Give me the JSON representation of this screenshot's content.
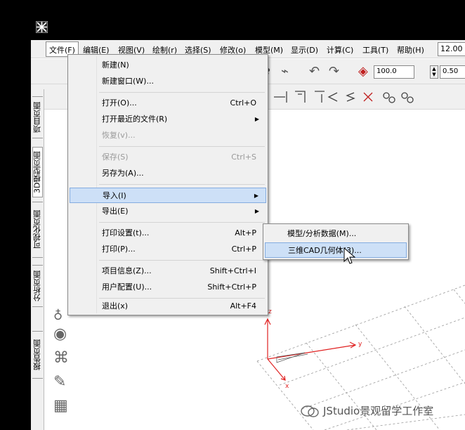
{
  "menubar": {
    "items": [
      "文件(F)",
      "编辑(E)",
      "视图(V)",
      "绘制(r)",
      "选择(S)",
      "修改(o)",
      "模型(M)",
      "显示(D)",
      "计算(C)",
      "工具(T)",
      "帮助(H)"
    ],
    "zoom_value": "12.00"
  },
  "toolbar": {
    "spin1_value": "100.0",
    "spin2_value": "0.50"
  },
  "file_menu": {
    "items": [
      {
        "label": "新建(N)",
        "shortcut": "",
        "disabled": false,
        "submenu": false
      },
      {
        "label": "新建窗口(W)...",
        "shortcut": "",
        "disabled": false,
        "submenu": false
      },
      {
        "label": "打开(O)...",
        "shortcut": "Ctrl+O",
        "disabled": false,
        "submenu": false
      },
      {
        "label": "打开最近的文件(R)",
        "shortcut": "",
        "disabled": false,
        "submenu": true
      },
      {
        "label": "恢复(v)...",
        "shortcut": "",
        "disabled": true,
        "submenu": false
      },
      {
        "label": "保存(S)",
        "shortcut": "Ctrl+S",
        "disabled": true,
        "submenu": false
      },
      {
        "label": "另存为(A)...",
        "shortcut": "",
        "disabled": false,
        "submenu": false
      },
      {
        "label": "导入(I)",
        "shortcut": "",
        "disabled": false,
        "submenu": true,
        "highlighted": true
      },
      {
        "label": "导出(E)",
        "shortcut": "",
        "disabled": false,
        "submenu": true
      },
      {
        "label": "打印设置(t)...",
        "shortcut": "Alt+P",
        "disabled": false,
        "submenu": false
      },
      {
        "label": "打印(P)...",
        "shortcut": "Ctrl+P",
        "disabled": false,
        "submenu": false
      },
      {
        "label": "项目信息(Z)...",
        "shortcut": "Shift+Ctrl+I",
        "disabled": false,
        "submenu": false
      },
      {
        "label": "用户配置(U)...",
        "shortcut": "Shift+Ctrl+P",
        "disabled": false,
        "submenu": false
      },
      {
        "label": "退出(x)",
        "shortcut": "Alt+F4",
        "disabled": false,
        "submenu": false
      }
    ]
  },
  "import_submenu": {
    "items": [
      {
        "label": "模型/分析数据(M)...",
        "highlighted": false
      },
      {
        "label": "三维CAD几何体(3)...",
        "highlighted": true
      }
    ]
  },
  "side_tabs": [
    "项目页面",
    "3D模型页面",
    "可视化页面",
    "分析页面",
    "报告页面"
  ],
  "axes": {
    "x": "x",
    "y": "y",
    "z": "z"
  },
  "watermark": "JStudio景观留学工作室",
  "colors": {
    "highlight": "#cde0f7",
    "axis": "#e02020",
    "grid": "#999999"
  },
  "icons": [
    "app-icon",
    "lightbulb-icon",
    "speaker-icon",
    "camera-icon",
    "sketch-icon",
    "watermark-icon"
  ]
}
